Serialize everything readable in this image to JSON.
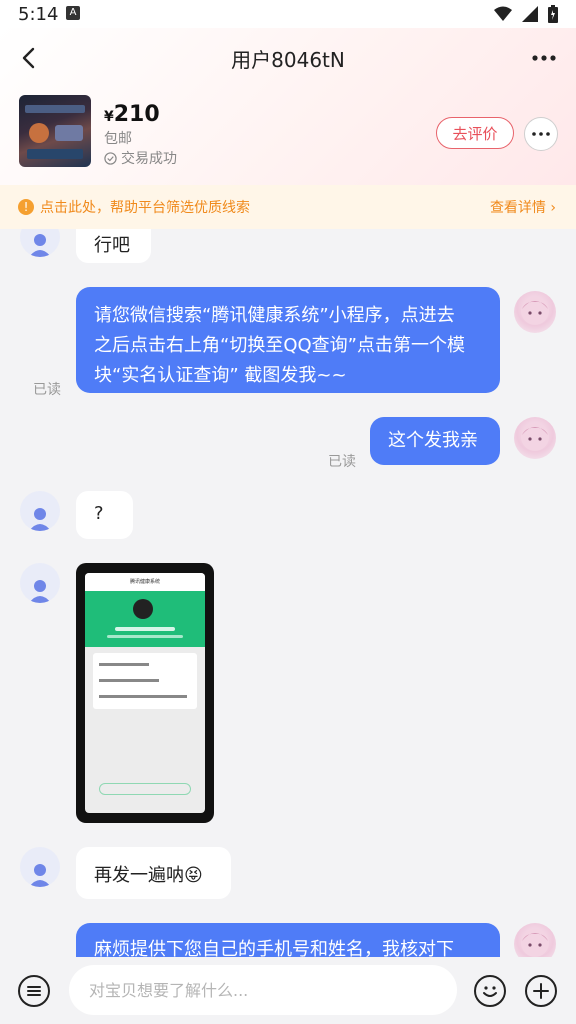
{
  "status_bar": {
    "time": "5:14",
    "notification_glyph": "A"
  },
  "header": {
    "title": "用户8046tN"
  },
  "product": {
    "currency": "¥",
    "price": "210",
    "shipping": "包邮",
    "status": "交易成功",
    "review_label": "去评价"
  },
  "notice": {
    "text": "点击此处，帮助平台筛选优质线索",
    "link": "查看详情"
  },
  "messages": {
    "m1": "行吧",
    "m2_lines": [
      "请您微信搜索“腾讯健康系统”小程序，点进去",
      "之后点击右上角“切换至QQ查询”点击第一个模",
      "块“实名认证查询” 截图发我~~"
    ],
    "m2_read": "已读",
    "m3": "这个发我亲",
    "m3_read": "已读",
    "m4": "?",
    "m6": "再发一遍呐😝",
    "m7": "麻烦提供下您自己的手机号和姓名，我核对下"
  },
  "image_message": {
    "title": "腾讯健康系统"
  },
  "input": {
    "placeholder": "对宝贝想要了解什么..."
  },
  "colors": {
    "accent_blue": "#4f7cf7",
    "review_red": "#e8505a",
    "notice_orange": "#f08a1c"
  }
}
